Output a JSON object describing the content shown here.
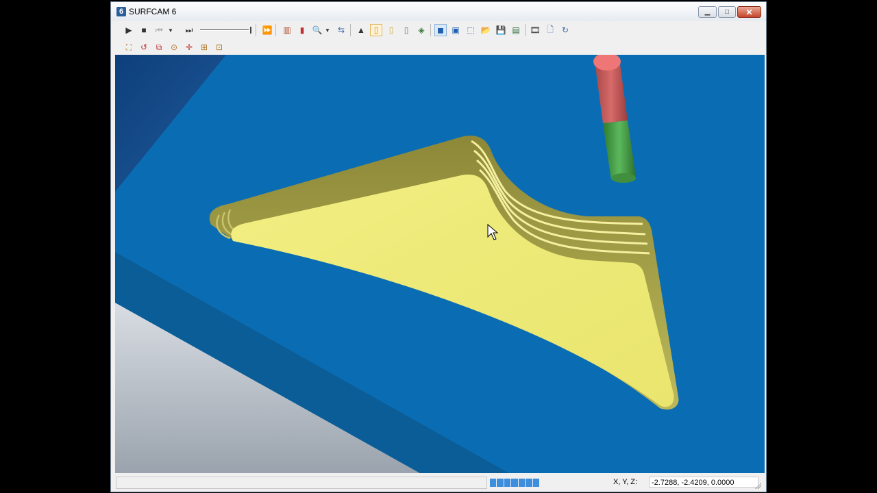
{
  "window": {
    "title": "SURFCAM 6",
    "app_icon_glyph": "6",
    "controls": {
      "minimize": "minimize-icon",
      "maximize": "maximize-icon",
      "close": "close-icon"
    }
  },
  "toolbar1": {
    "items": [
      "play-icon",
      "stop-icon",
      "step-back-icon",
      "dropdown-icon",
      "step-forward-icon",
      "speed-slider",
      "fast-forward-icon",
      "section-icon",
      "stock-compare-icon",
      "zoom-icon",
      "zoom-dropdown-icon",
      "refresh-icon",
      "tool-shape-icon",
      "tool-holder-icon",
      "tool-icon",
      "tool-outline-icon",
      "stock-icon",
      "shaded-view-icon",
      "wireframe-view-icon",
      "hidden-line-icon",
      "open-file-icon",
      "save-icon",
      "save-as-icon",
      "film-icon",
      "page-icon",
      "rotate-icon"
    ]
  },
  "toolbar2": {
    "items": [
      "zoom-extents-icon",
      "rotate-view-icon",
      "zoom-window-icon",
      "pan-view-icon",
      "center-view-icon",
      "fit-icon",
      "dynamic-zoom-icon"
    ]
  },
  "viewport": {
    "colors": {
      "background_blue": "#0a6db3",
      "part_yellow": "#eeea7a",
      "wall_olive": "#9c9845",
      "stock_side": "#0b5d97",
      "tool_red": "#c85656",
      "tool_green": "#4a9e4a"
    }
  },
  "status": {
    "message": "",
    "progress_segments": 7,
    "coord_label": "X, Y, Z:",
    "coord_value": "-2.7288, -2.4209, 0.0000"
  }
}
